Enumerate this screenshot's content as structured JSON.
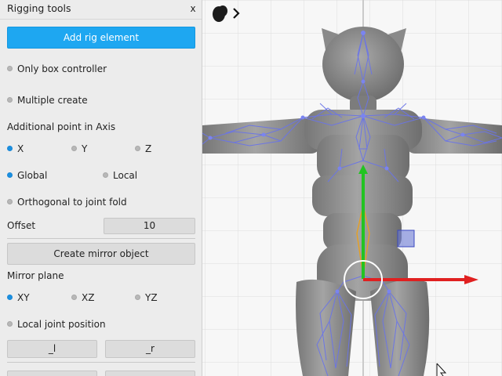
{
  "panel": {
    "title": "Rigging tools",
    "close_label": "x",
    "add_rig_label": "Add rig element",
    "only_box_label": "Only box controller",
    "multiple_create_label": "Multiple create",
    "axis_heading": "Additional point in Axis",
    "axis_options": [
      "X",
      "Y",
      "Z"
    ],
    "axis_selected": "X",
    "space_options": [
      "Global",
      "Local"
    ],
    "space_selected": "Global",
    "orthogonal_label": "Orthogonal to joint fold",
    "offset_label": "Offset",
    "offset_value": "10",
    "mirror_button_label": "Create mirror object",
    "mirror_plane_heading": "Mirror plane",
    "plane_options": [
      "XY",
      "XZ",
      "YZ"
    ],
    "plane_selected": "XY",
    "local_joint_label": "Local joint position",
    "suffix_left_label": "_l",
    "suffix_right_label": "_r"
  },
  "viewport": {
    "colors": {
      "model": "#8f8f8f",
      "bones": "#6a74e8",
      "axis_x": "#e02020",
      "axis_y": "#22c422",
      "selected_bone": "#e8a020"
    },
    "icons": [
      "logo-icon",
      "chevron-right-icon",
      "mouse-cursor-icon"
    ]
  }
}
